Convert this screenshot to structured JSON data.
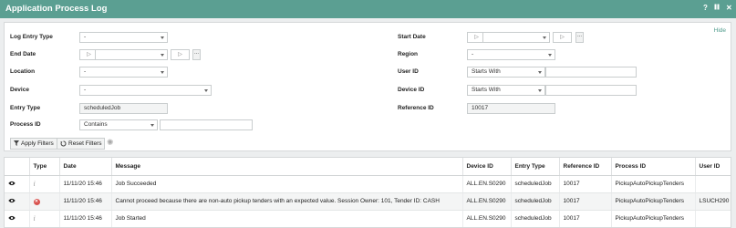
{
  "window": {
    "title": "Application Process Log",
    "help_label": "?",
    "maximize_label": "⏸",
    "close_label": "✕"
  },
  "filters": {
    "hide_label": "Hide",
    "log_entry_type": {
      "label": "Log Entry Type",
      "value": "-"
    },
    "end_date": {
      "label": "End Date",
      "time_placeholder": "▷",
      "dots": "..."
    },
    "location": {
      "label": "Location",
      "value": "-"
    },
    "device": {
      "label": "Device",
      "value": "-"
    },
    "entry_type": {
      "label": "Entry Type",
      "value": "scheduledJob"
    },
    "process_id": {
      "label": "Process ID",
      "operator": "Contains",
      "value": ""
    },
    "start_date": {
      "label": "Start Date",
      "time_placeholder": "▷",
      "dots": "..."
    },
    "region": {
      "label": "Region",
      "value": "-"
    },
    "user_id": {
      "label": "User ID",
      "operator": "Starts With",
      "value": ""
    },
    "device_id": {
      "label": "Device ID",
      "operator": "Starts With",
      "value": ""
    },
    "reference_id": {
      "label": "Reference ID",
      "value": "10017"
    },
    "apply_label": "Apply Filters",
    "reset_label": "Reset Filters"
  },
  "grid": {
    "columns": [
      "",
      "Type",
      "Date",
      "Message",
      "Device ID",
      "Entry Type",
      "Reference ID",
      "Process ID",
      "User ID"
    ],
    "rows": [
      {
        "type": "info",
        "date": "11/11/20 15:46",
        "message": "Job Succeeded",
        "device_id": "ALL.EN.S0290",
        "entry_type": "scheduledJob",
        "reference_id": "10017",
        "process_id": "PickupAutoPickupTenders",
        "user_id": ""
      },
      {
        "type": "error",
        "date": "11/11/20 15:46",
        "message": "Cannot proceed because there are non-auto pickup tenders with an expected value. Session Owner: 101, Tender ID: CASH",
        "device_id": "ALL.EN.S0290",
        "entry_type": "scheduledJob",
        "reference_id": "10017",
        "process_id": "PickupAutoPickupTenders",
        "user_id": "LSUCH290"
      },
      {
        "type": "info",
        "date": "11/11/20 15:46",
        "message": "Job Started",
        "device_id": "ALL.EN.S0290",
        "entry_type": "scheduledJob",
        "reference_id": "10017",
        "process_id": "PickupAutoPickupTenders",
        "user_id": ""
      }
    ]
  },
  "icons": {
    "view": "eye-icon",
    "info": "info-icon",
    "error": "error-icon",
    "filter": "filter-icon",
    "reset": "reset-icon",
    "spinner": "loading-spinner-icon"
  },
  "colors": {
    "titlebar": "#5b9f92",
    "hide_link": "#4f9b8c",
    "error": "#d9534f"
  }
}
